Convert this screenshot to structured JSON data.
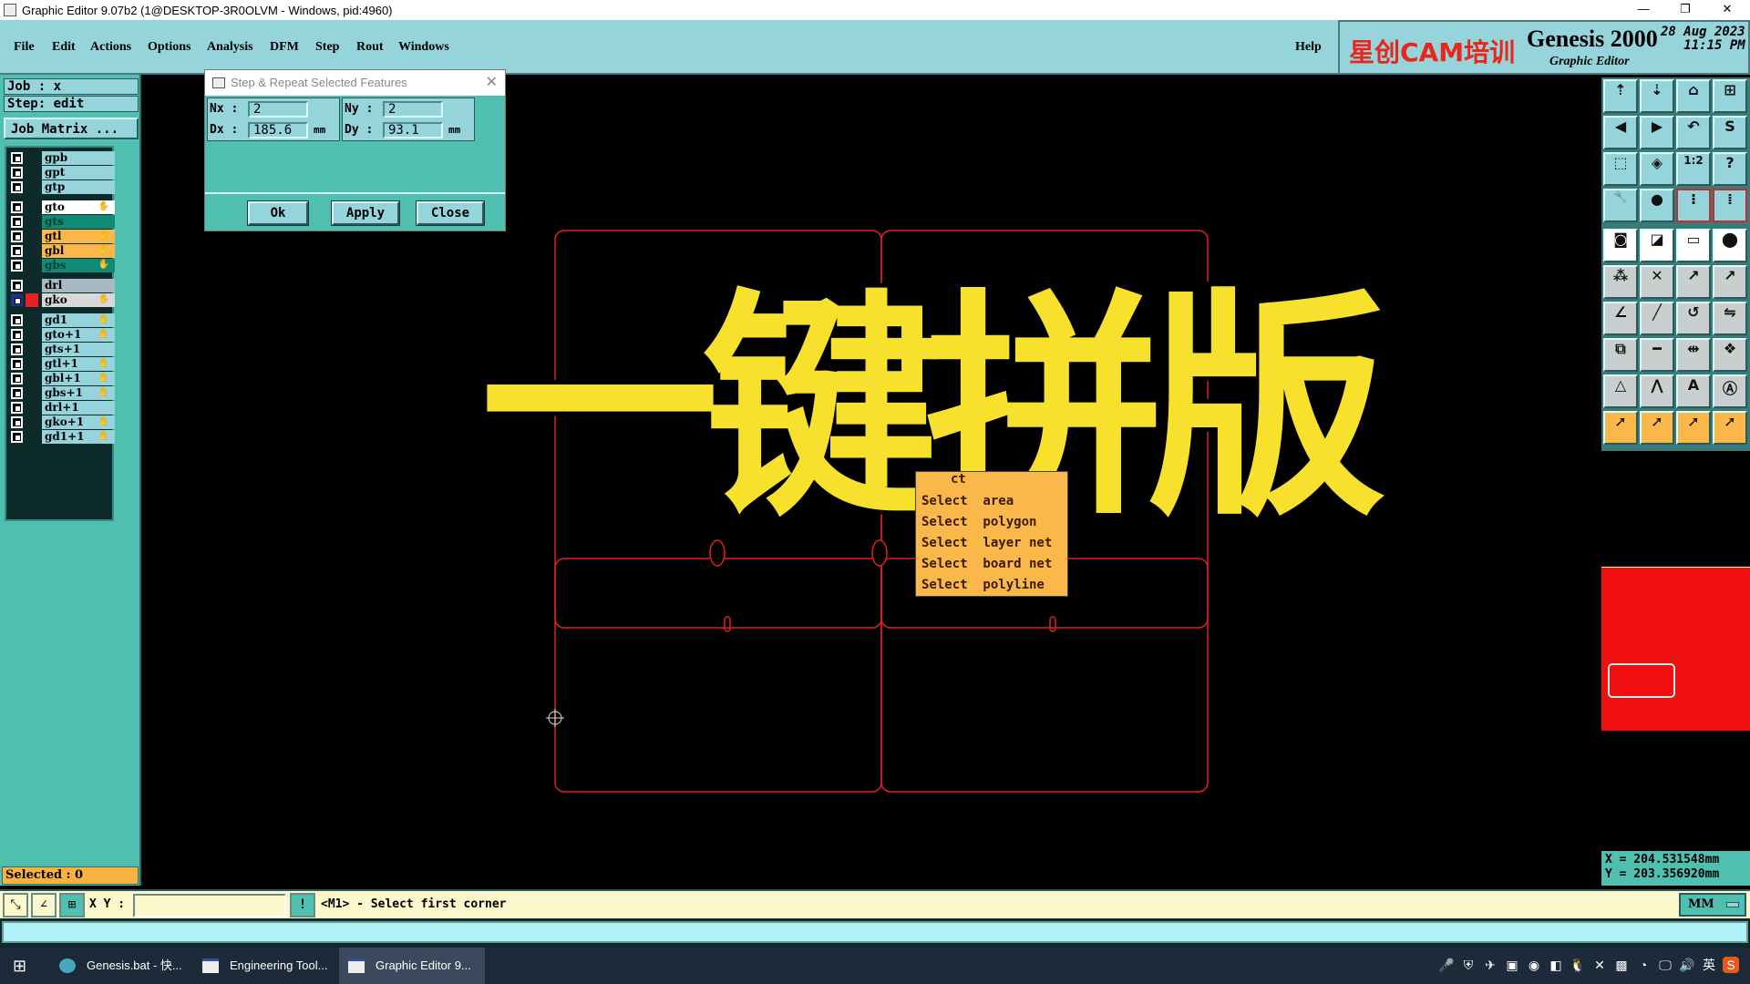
{
  "window": {
    "title": "Graphic Editor 9.07b2 (1@DESKTOP-3R0OLVM - Windows, pid:4960)",
    "controls": [
      "—",
      "❐",
      "✕"
    ]
  },
  "menu": [
    "File",
    "Edit",
    "Actions",
    "Options",
    "Analysis",
    "DFM",
    "Step",
    "Rout",
    "Windows"
  ],
  "help": "Help",
  "brand": {
    "cn": "星创CAM培训",
    "product": "Genesis 2000",
    "subtitle": "Graphic Editor",
    "date": "28 Aug 2023",
    "time": "11:15 PM"
  },
  "left": {
    "job": "Job : x",
    "step": "Step: edit",
    "job_matrix": "Job Matrix ...",
    "selected": "Selected : 0"
  },
  "layers": [
    {
      "name": "gpb",
      "color": "#96d4dc",
      "hand": false
    },
    {
      "name": "gpt",
      "color": "#96d4dc",
      "hand": false
    },
    {
      "name": "gtp",
      "color": "#96d4dc",
      "hand": false
    },
    {
      "name": "gto",
      "color": "#ffffff",
      "hand": true
    },
    {
      "name": "gts",
      "color": "#108a74",
      "hand": false
    },
    {
      "name": "gtl",
      "color": "#fbb84a",
      "hand": true
    },
    {
      "name": "gbl",
      "color": "#fbb84a",
      "hand": true
    },
    {
      "name": "gbs",
      "color": "#108a74",
      "hand": true
    },
    {
      "name": "drl",
      "color": "#a8b8c4",
      "hand": false
    },
    {
      "name": "gko",
      "color": "#d8d8d8",
      "hand": true,
      "active": true
    },
    {
      "name": "gd1",
      "color": "#96d4dc",
      "hand": true
    },
    {
      "name": "gto+1",
      "color": "#96d4dc",
      "hand": true
    },
    {
      "name": "gts+1",
      "color": "#96d4dc",
      "hand": false
    },
    {
      "name": "gtl+1",
      "color": "#96d4dc",
      "hand": true
    },
    {
      "name": "gbl+1",
      "color": "#96d4dc",
      "hand": true
    },
    {
      "name": "gbs+1",
      "color": "#96d4dc",
      "hand": true
    },
    {
      "name": "drl+1",
      "color": "#96d4dc",
      "hand": false
    },
    {
      "name": "gko+1",
      "color": "#96d4dc",
      "hand": true
    },
    {
      "name": "gd1+1",
      "color": "#96d4dc",
      "hand": true
    }
  ],
  "dialog": {
    "title": "Step & Repeat Selected Features",
    "nx_label": "Nx :",
    "nx": "2",
    "ny_label": "Ny :",
    "ny": "2",
    "dx_label": "Dx :",
    "dx": "185.6",
    "dy_label": "Dy :",
    "dy": "93.1",
    "unit": "mm",
    "ok": "Ok",
    "apply": "Apply",
    "close": "Close"
  },
  "overlay_text": "一键拼版",
  "popup": {
    "partial": "ct",
    "items": [
      "Select  area",
      "Select  polygon",
      "Select  layer net",
      "Select  board net",
      "Select  polyline"
    ]
  },
  "coords": {
    "x": "X = 204.531548mm",
    "y": "Y = 203.356920mm"
  },
  "status": {
    "xy_label": "X Y :",
    "xy_value": "",
    "message": "<M1> - Select first corner",
    "units": "MM"
  },
  "taskbar": [
    {
      "label": "Genesis.bat - 快..."
    },
    {
      "label": "Engineering Tool..."
    },
    {
      "label": "Graphic Editor 9...",
      "active": true
    }
  ],
  "tray": [
    "microphone-icon",
    "security-icon",
    "app-icon",
    "capture-icon",
    "record-icon",
    "app-orange-icon",
    "qq-icon",
    "x-icon",
    "nvidia-icon",
    "speaker-tool-icon",
    "network-icon",
    "volume-icon",
    "ime-icon",
    "sogou-icon"
  ],
  "ime": "英",
  "accent": {
    "board_outline": "#e02020",
    "panel_bg": "#96d4dc",
    "teal": "#4fbfb0"
  }
}
